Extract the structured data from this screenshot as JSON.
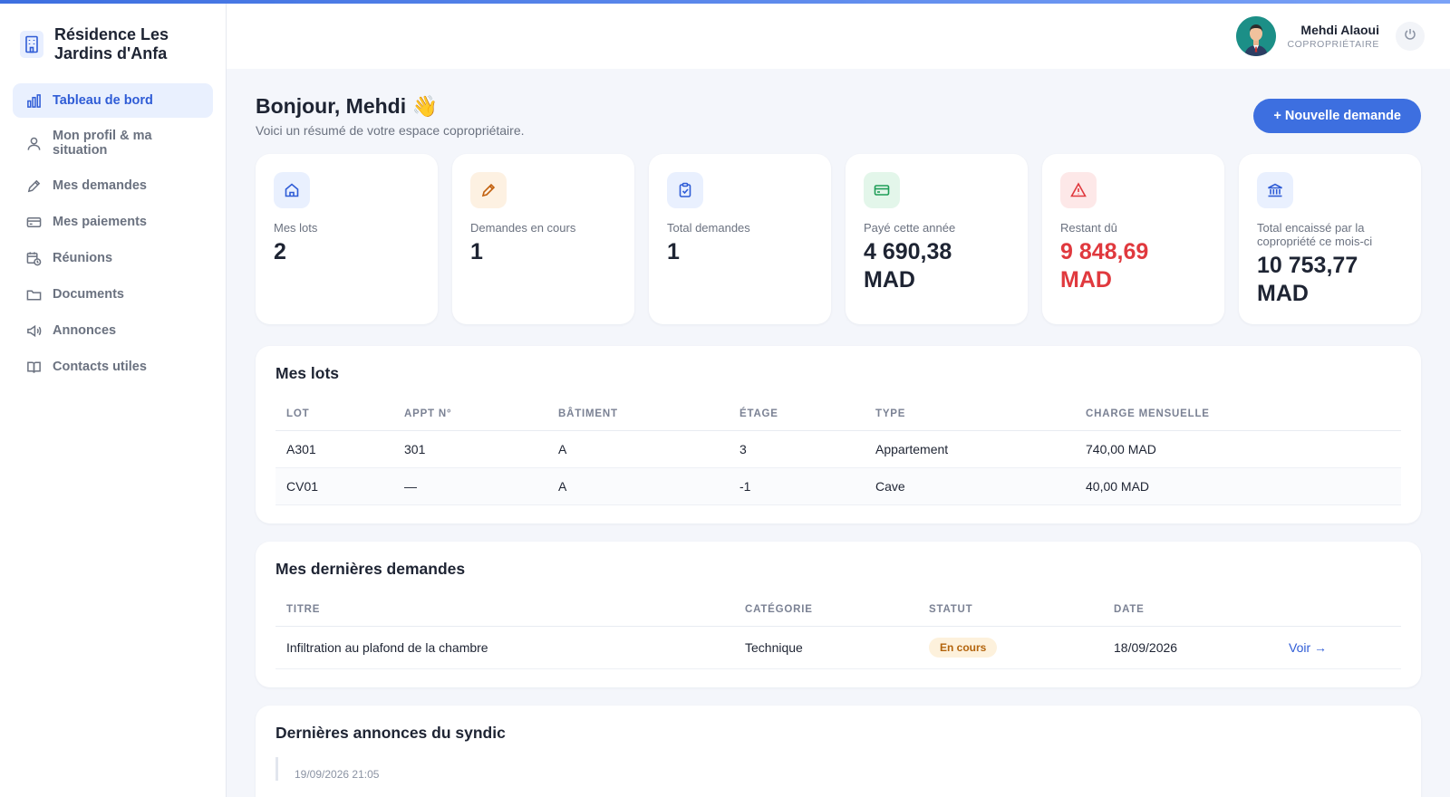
{
  "brand": {
    "name": "Résidence Les Jardins d'Anfa"
  },
  "sidebar": {
    "items": [
      {
        "label": "Tableau de bord",
        "icon": "bar-chart-icon",
        "active": true
      },
      {
        "label": "Mon profil & ma situation",
        "icon": "user-icon",
        "active": false
      },
      {
        "label": "Mes demandes",
        "icon": "pencil-icon",
        "active": false
      },
      {
        "label": "Mes paiements",
        "icon": "credit-card-icon",
        "active": false
      },
      {
        "label": "Réunions",
        "icon": "calendar-clock-icon",
        "active": false
      },
      {
        "label": "Documents",
        "icon": "folder-icon",
        "active": false
      },
      {
        "label": "Annonces",
        "icon": "megaphone-icon",
        "active": false
      },
      {
        "label": "Contacts utiles",
        "icon": "book-icon",
        "active": false
      }
    ]
  },
  "header": {
    "user_name": "Mehdi Alaoui",
    "user_role": "COPROPRIÉTAIRE"
  },
  "main": {
    "greeting": "Bonjour, Mehdi 👋",
    "subtitle": "Voici un résumé de votre espace copropriétaire.",
    "new_request_label": "+ Nouvelle demande",
    "stats": [
      {
        "label": "Mes lots",
        "value": "2",
        "icon": "home-icon",
        "color": "#2f5cd6",
        "bg": "#e9f0fe"
      },
      {
        "label": "Demandes en cours",
        "value": "1",
        "icon": "pencil-icon",
        "color": "#c2610f",
        "bg": "#fdf1e2"
      },
      {
        "label": "Total demandes",
        "value": "1",
        "icon": "clipboard-check-icon",
        "color": "#2f5cd6",
        "bg": "#e9f0fe"
      },
      {
        "label": "Payé cette année",
        "value": "4 690,38 MAD",
        "icon": "credit-card-icon",
        "color": "#1f9d57",
        "bg": "#e3f6ea"
      },
      {
        "label": "Restant dû",
        "value": "9 848,69 MAD",
        "icon": "alert-triangle-icon",
        "color": "#e0393e",
        "bg": "#fde8e8",
        "danger": true
      },
      {
        "label": "Total encaissé par la copropriété ce mois-ci",
        "value": "10 753,77 MAD",
        "icon": "bank-icon",
        "color": "#2f5cd6",
        "bg": "#e9f0fe"
      }
    ]
  },
  "lots": {
    "title": "Mes lots",
    "columns": [
      "LOT",
      "APPT N°",
      "BÂTIMENT",
      "ÉTAGE",
      "TYPE",
      "CHARGE MENSUELLE"
    ],
    "rows": [
      [
        "A301",
        "301",
        "A",
        "3",
        "Appartement",
        "740,00 MAD"
      ],
      [
        "CV01",
        "—",
        "A",
        "-1",
        "Cave",
        "40,00 MAD"
      ]
    ]
  },
  "requests": {
    "title": "Mes dernières demandes",
    "columns": [
      "TITRE",
      "CATÉGORIE",
      "STATUT",
      "DATE",
      ""
    ],
    "rows": [
      {
        "title": "Infiltration au plafond de la chambre",
        "category": "Technique",
        "status": "En cours",
        "date": "18/09/2026",
        "action": "Voir →"
      }
    ]
  },
  "announcements": {
    "title": "Dernières annonces du syndic",
    "first_date": "19/09/2026 21:05"
  }
}
